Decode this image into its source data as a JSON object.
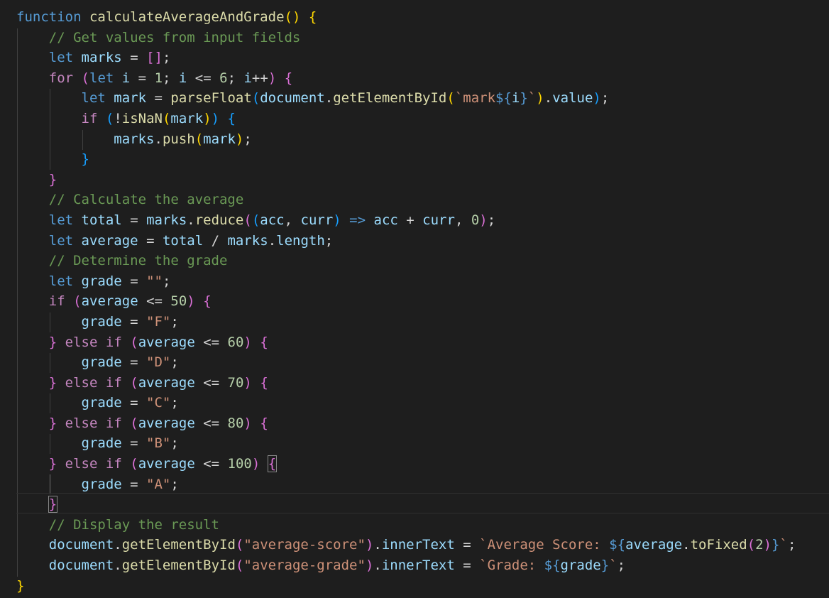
{
  "editor": {
    "theme": "dark",
    "background": "#1e1e1e",
    "colors": {
      "keyword": "#569cd6",
      "control": "#c586c0",
      "function": "#dcdcaa",
      "variable": "#9cdcfe",
      "string": "#ce9178",
      "number": "#b5cea8",
      "comment": "#6a9955",
      "bracket_1": "#ffd700",
      "bracket_2": "#da70d6",
      "bracket_3": "#179fff"
    },
    "code": {
      "fn_keyword": "function",
      "fn_name": "calculateAverageAndGrade",
      "comment_get_values": "// Get values from input fields",
      "comment_average": "// Calculate the average",
      "comment_grade": "// Determine the grade",
      "comment_display": "// Display the result",
      "let_kw": "let",
      "for_kw": "for",
      "if_kw": "if",
      "else_kw": "else",
      "var_marks": "marks",
      "var_i": "i",
      "var_mark": "mark",
      "var_total": "total",
      "var_average": "average",
      "var_grade": "grade",
      "var_acc": "acc",
      "var_curr": "curr",
      "var_document": "document",
      "fn_parseFloat": "parseFloat",
      "fn_getElementById": "getElementById",
      "fn_isNaN": "isNaN",
      "fn_push": "push",
      "fn_reduce": "reduce",
      "fn_toFixed": "toFixed",
      "prop_value": "value",
      "prop_length": "length",
      "prop_innerText": "innerText",
      "num_1": "1",
      "num_6": "6",
      "num_0": "0",
      "num_2": "2",
      "num_50": "50",
      "num_60": "60",
      "num_70": "70",
      "num_80": "80",
      "num_100": "100",
      "str_empty": "\"\"",
      "str_F": "\"F\"",
      "str_D": "\"D\"",
      "str_C": "\"C\"",
      "str_B": "\"B\"",
      "str_A": "\"A\"",
      "str_mark_tpl": "mark",
      "str_avg_score_id": "\"average-score\"",
      "str_avg_grade_id": "\"average-grade\"",
      "tpl_avg_score": "Average Score: ",
      "tpl_grade": "Grade: "
    }
  }
}
